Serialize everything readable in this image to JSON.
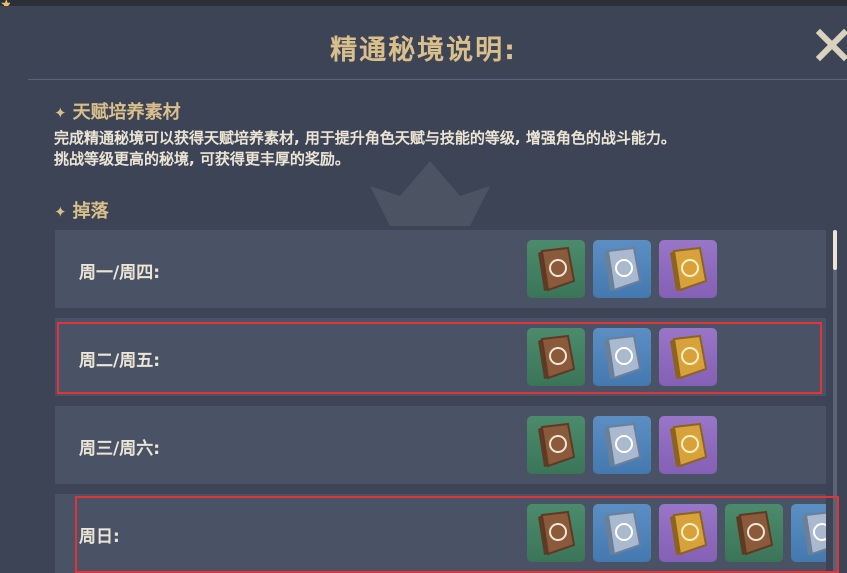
{
  "dialog": {
    "title": "精通秘境说明:",
    "close_icon": "close-x-icon"
  },
  "sections": {
    "talent": {
      "heading": "天赋培养素材",
      "description_line1": "完成精通秘境可以获得天赋培养素材, 用于提升角色天赋与技能的等级, 增强角色的战斗能力。",
      "description_line2": "挑战等级更高的秘境, 可获得更丰厚的奖励。"
    },
    "drops": {
      "heading": "掉落"
    }
  },
  "rows": [
    {
      "label": "周一/周四:",
      "items": [
        "green-book-icon",
        "blue-book-icon",
        "purple-book-icon"
      ],
      "highlighted": false
    },
    {
      "label": "周二/周五:",
      "items": [
        "green-book-icon",
        "blue-book-icon",
        "purple-book-icon"
      ],
      "highlighted": true
    },
    {
      "label": "周三/周六:",
      "items": [
        "green-book-icon",
        "blue-book-icon",
        "purple-book-icon"
      ],
      "highlighted": false
    },
    {
      "label": "周日:",
      "items": [
        "green-book-icon",
        "blue-book-icon",
        "purple-book-icon",
        "green-book-icon",
        "blue-book-icon"
      ],
      "highlighted": true
    }
  ],
  "colors": {
    "accent_gold": "#d9bf8c",
    "highlight_red": "#e0333a",
    "rarity_green": "#4b8b6c",
    "rarity_blue": "#5b8fc4",
    "rarity_purple": "#9a76c8"
  }
}
